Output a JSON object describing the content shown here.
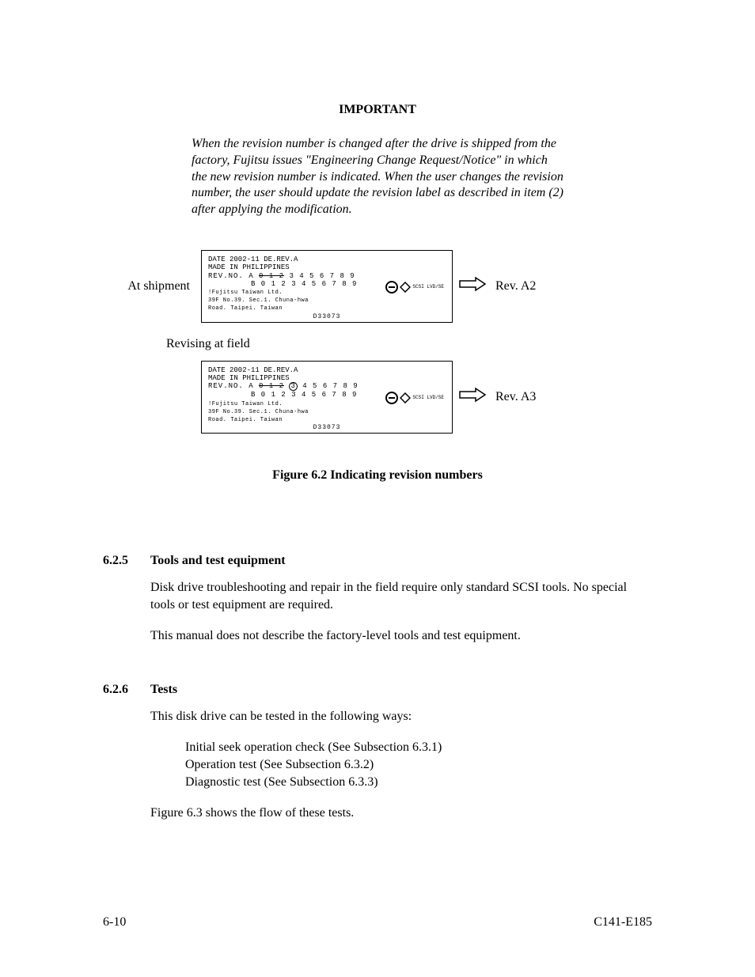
{
  "important": {
    "heading": "IMPORTANT",
    "text": "When the revision number is changed after the drive is shipped from the factory, Fujitsu issues \"Engineering Change Request/Notice\" in which the new revision number is indicated.  When the user changes the revision number, the user should update the revision label as described in item (2) after applying the modification."
  },
  "figure": {
    "at_shipment_label": "At shipment",
    "revising_label": "Revising at field",
    "rev_a2": "Rev. A2",
    "rev_a3": "Rev. A3",
    "caption": "Figure 6.2    Indicating revision numbers",
    "label_content": {
      "line1": "DATE 2002-11  DE.REV.A",
      "line2": "MADE IN PHILIPPINES",
      "rev_prefix": "REV.NO. A ",
      "rowA_struck_012": "0 1 2",
      "rowA_num_3": "3",
      "rowA_rest": " 4 5 6 7 8 9",
      "rowB": "B 0 1 2 3 4 5 6 7 8 9",
      "addr1": "!Fujitsu Taiwan Ltd.",
      "addr2": "39F No.39. Sec.1. Chuna-hwa",
      "addr3": "Road. Taipei. Taiwan",
      "bottom_code": "D33073",
      "mark_text": "SCSI LVD/SE"
    }
  },
  "sections": {
    "s625": {
      "num": "6.2.5",
      "title": "Tools and test equipment",
      "p1": "Disk drive troubleshooting and repair in the field require only standard SCSI tools.  No special tools or test equipment are required.",
      "p2": "This manual does not describe the factory-level tools and test equipment."
    },
    "s626": {
      "num": "6.2.6",
      "title": "Tests",
      "p1": "This disk drive can be tested in the following ways:",
      "list1": "Initial seek operation check  (See Subsection 6.3.1)",
      "list2": "Operation test  (See Subsection 6.3.2)",
      "list3": "Diagnostic test  (See Subsection 6.3.3)",
      "p2": "Figure 6.3 shows the flow of these tests."
    }
  },
  "footer": {
    "left": "6-10",
    "right": "C141-E185"
  }
}
